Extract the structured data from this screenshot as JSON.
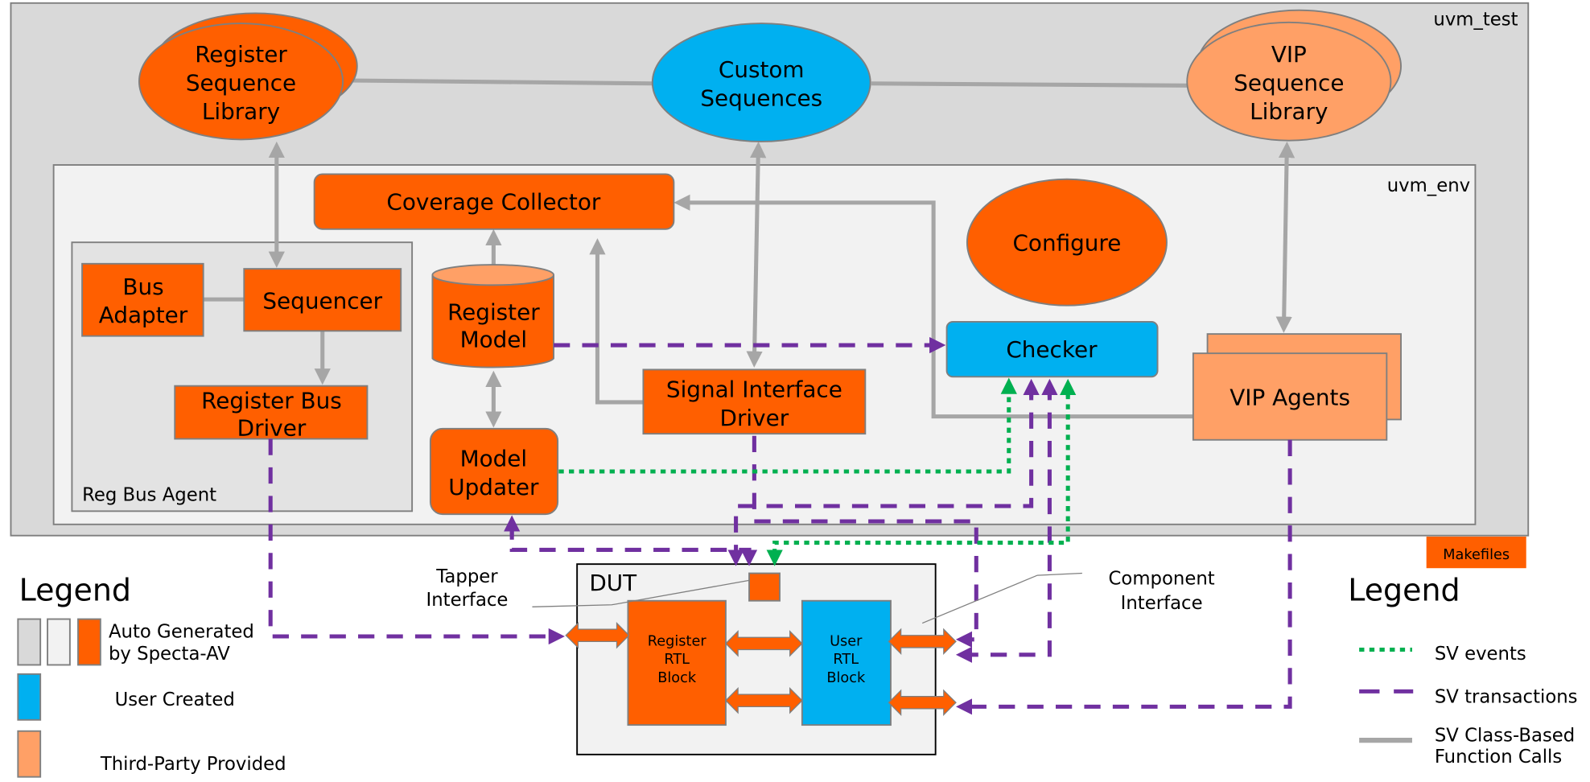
{
  "colors": {
    "auto_dark": "#d9d9d9",
    "auto_light": "#f2f2f2",
    "orange": "#ff5f00",
    "user": "#00b0f0",
    "third_party": "#ffa066",
    "events": "#00b050",
    "transactions": "#7030a0",
    "calls": "#a6a6a6"
  },
  "containers": {
    "uvm_test": "uvm_test",
    "uvm_env": "uvm_env",
    "reg_bus_agent": "Reg Bus Agent",
    "dut": "DUT"
  },
  "nodes": {
    "reg_seq_lib": [
      "Register",
      "Sequence",
      "Library"
    ],
    "custom_seq": [
      "Custom",
      "Sequences"
    ],
    "vip_seq_lib": [
      "VIP",
      "Sequence",
      "Library"
    ],
    "coverage": "Coverage Collector",
    "configure": "Configure",
    "bus_adapter": [
      "Bus",
      "Adapter"
    ],
    "sequencer": "Sequencer",
    "reg_bus_driver": [
      "Register Bus",
      "Driver"
    ],
    "reg_model": [
      "Register",
      "Model"
    ],
    "model_updater": [
      "Model",
      "Updater"
    ],
    "sig_if_driver": [
      "Signal Interface",
      "Driver"
    ],
    "checker": "Checker",
    "vip_agents": "VIP Agents",
    "makefiles": "Makefiles",
    "reg_rtl": [
      "Register",
      "RTL",
      "Block"
    ],
    "user_rtl": [
      "User",
      "RTL",
      "Block"
    ]
  },
  "annotations": {
    "tapper": [
      "Tapper",
      "Interface"
    ],
    "component": [
      "Component",
      "Interface"
    ]
  },
  "legend_left": {
    "title": "Legend",
    "items": [
      {
        "label": [
          "Auto Generated",
          "by Specta-AV"
        ]
      },
      {
        "label": [
          "User Created"
        ]
      },
      {
        "label": [
          "Third-Party Provided"
        ]
      }
    ]
  },
  "legend_right": {
    "title": "Legend",
    "items": [
      {
        "label": [
          "SV events"
        ]
      },
      {
        "label": [
          "SV transactions"
        ]
      },
      {
        "label": [
          "SV Class-Based",
          "Function Calls"
        ]
      }
    ]
  }
}
